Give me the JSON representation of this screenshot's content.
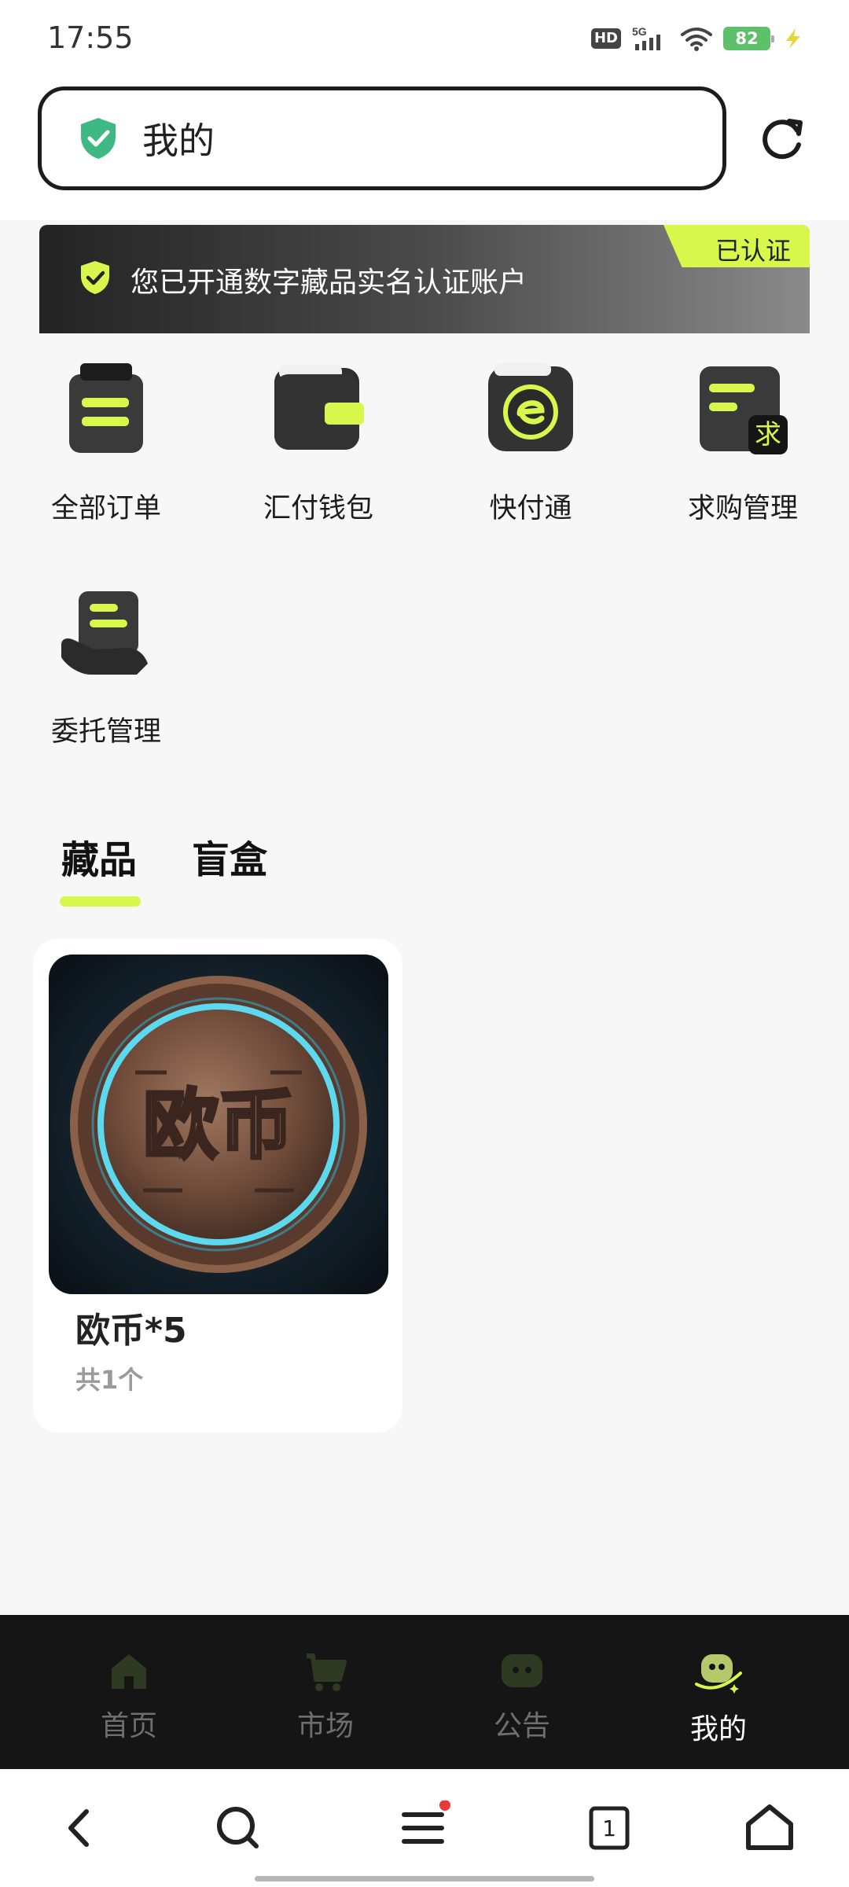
{
  "status_bar": {
    "time": "17:55",
    "hd": "HD",
    "network": "5G",
    "battery": "82"
  },
  "address_bar": {
    "title": "我的"
  },
  "cert_banner": {
    "text": "您已开通数字藏品实名认证账户",
    "tag": "已认证"
  },
  "menu": {
    "items": [
      {
        "label": "全部订单",
        "icon": "orders-icon"
      },
      {
        "label": "汇付钱包",
        "icon": "wallet-icon"
      },
      {
        "label": "快付通",
        "icon": "quick-pay-icon"
      },
      {
        "label": "求购管理",
        "icon": "purchase-request-icon"
      },
      {
        "label": "委托管理",
        "icon": "consignment-icon"
      }
    ],
    "purchase_badge": "求"
  },
  "tabs": {
    "items": [
      {
        "label": "藏品",
        "active": true
      },
      {
        "label": "盲盒",
        "active": false
      }
    ]
  },
  "collection": {
    "items": [
      {
        "title": "欧币*5",
        "count": "共1个",
        "image_text": "欧币"
      }
    ]
  },
  "bottom_nav": {
    "items": [
      {
        "label": "首页",
        "icon": "home-icon",
        "active": false
      },
      {
        "label": "市场",
        "icon": "cart-icon",
        "active": false
      },
      {
        "label": "公告",
        "icon": "chat-icon",
        "active": false
      },
      {
        "label": "我的",
        "icon": "profile-mascot-icon",
        "active": true
      }
    ]
  },
  "system_bar": {
    "tab_count": "1"
  },
  "colors": {
    "accent": "#d8f64c",
    "dark": "#1c1c1c",
    "nav_bg": "#151515",
    "secure_green": "#3fb984"
  }
}
